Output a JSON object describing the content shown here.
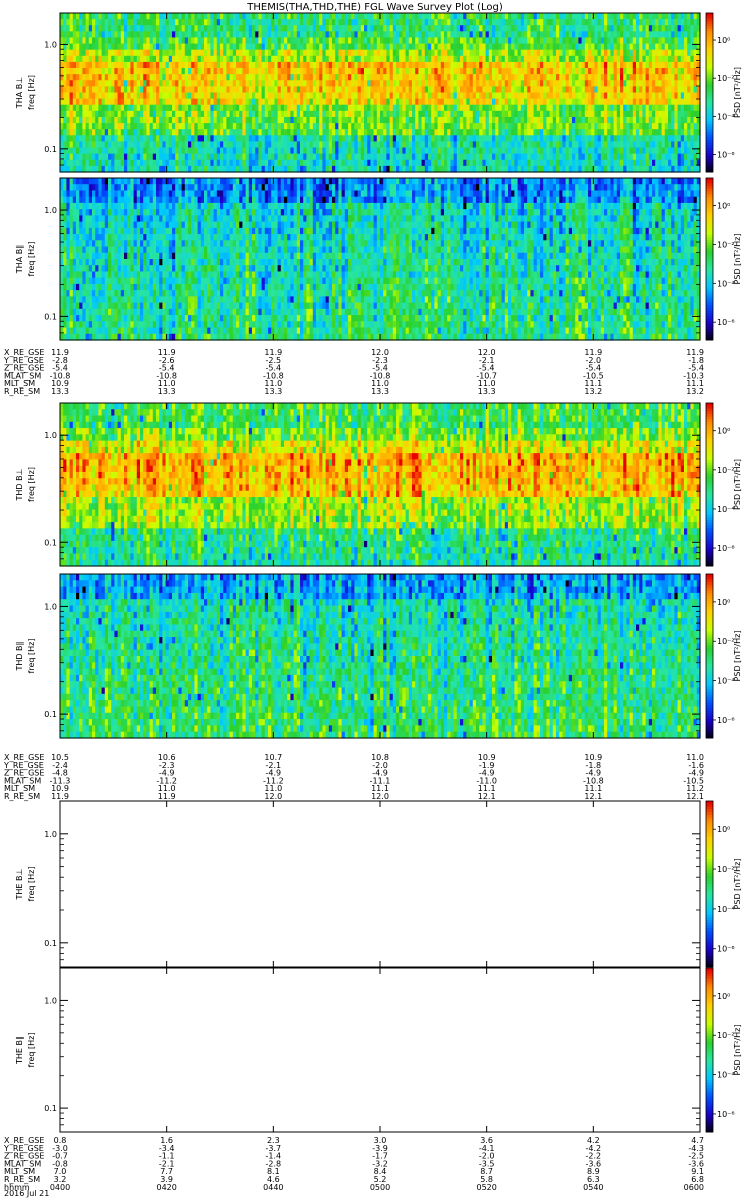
{
  "chart_data": {
    "type": "heatmap",
    "title": "THEMIS(THA,THD,THE) FGL Wave Survey Plot (Log)",
    "x_axis_type": "time",
    "x_range": [
      "0400",
      "0600"
    ],
    "y_scale": "log",
    "ylim": [
      0.06,
      2.0
    ],
    "y_ticks": [
      0.1,
      1.0
    ],
    "y_tick_labels": [
      "0.1",
      "1.0"
    ],
    "colorbar": {
      "label": "PSD [nT²/Hz]",
      "scale": "log",
      "ticks": [
        "10⁰",
        "10⁻²",
        "10⁻⁴",
        "10⁻⁶"
      ],
      "colormap": [
        "#000000",
        "#1a00c8",
        "#0050ff",
        "#00c8ff",
        "#28e6a0",
        "#2bd12b",
        "#c8ff00",
        "#ffd000",
        "#ff8c00",
        "#e60000"
      ]
    },
    "panels": [
      {
        "probe": "THA",
        "component": "B⊥",
        "ylabel": "THA B⊥\nfreq [Hz]",
        "has_data": true,
        "mean_level": 0.66
      },
      {
        "probe": "THA",
        "component": "B∥",
        "ylabel": "THA B∥\nfreq [Hz]",
        "has_data": true,
        "mean_level": 0.38
      },
      {
        "probe": "THD",
        "component": "B⊥",
        "ylabel": "THD B⊥\nfreq [Hz]",
        "has_data": true,
        "mean_level": 0.7
      },
      {
        "probe": "THD",
        "component": "B∥",
        "ylabel": "THD B∥\nfreq [Hz]",
        "has_data": true,
        "mean_level": 0.4
      },
      {
        "probe": "THE",
        "component": "B⊥",
        "ylabel": "THE B⊥\nfreq [Hz]",
        "has_data": false
      },
      {
        "probe": "THE",
        "component": "B∥",
        "ylabel": "THE B∥\nfreq [Hz]",
        "has_data": false
      }
    ],
    "ephemeris_blocks": [
      {
        "probe": "THA",
        "rows": [
          {
            "label": "X_RE_GSE",
            "values": [
              "11.9",
              "11.9",
              "11.9",
              "12.0",
              "12.0",
              "11.9",
              "11.9"
            ]
          },
          {
            "label": "Y_RE_GSE",
            "values": [
              "-2.8",
              "-2.6",
              "-2.5",
              "-2.3",
              "-2.1",
              "-2.0",
              "-1.8"
            ]
          },
          {
            "label": "Z_RE_GSE",
            "values": [
              "-5.4",
              "-5.4",
              "-5.4",
              "-5.4",
              "-5.4",
              "-5.4",
              "-5.4"
            ]
          },
          {
            "label": "MLAT_SM",
            "values": [
              "-10.8",
              "-10.8",
              "-10.8",
              "-10.8",
              "-10.7",
              "-10.5",
              "-10.3"
            ]
          },
          {
            "label": "MLT_SM",
            "values": [
              "10.9",
              "11.0",
              "11.0",
              "11.0",
              "11.0",
              "11.1",
              "11.1"
            ]
          },
          {
            "label": "R_RE_SM",
            "values": [
              "13.3",
              "13.3",
              "13.3",
              "13.3",
              "13.3",
              "13.2",
              "13.2"
            ]
          }
        ]
      },
      {
        "probe": "THD",
        "rows": [
          {
            "label": "X_RE_GSE",
            "values": [
              "10.5",
              "10.6",
              "10.7",
              "10.8",
              "10.9",
              "10.9",
              "11.0"
            ]
          },
          {
            "label": "Y_RE_GSE",
            "values": [
              "-2.4",
              "-2.3",
              "-2.1",
              "-2.0",
              "-1.9",
              "-1.8",
              "-1.6"
            ]
          },
          {
            "label": "Z_RE_GSE",
            "values": [
              "-4.8",
              "-4.9",
              "-4.9",
              "-4.9",
              "-4.9",
              "-4.9",
              "-4.9"
            ]
          },
          {
            "label": "MLAT_SM",
            "values": [
              "-11.3",
              "-11.2",
              "-11.2",
              "-11.1",
              "-11.0",
              "-10.8",
              "-10.5"
            ]
          },
          {
            "label": "MLT_SM",
            "values": [
              "10.9",
              "11.0",
              "11.0",
              "11.1",
              "11.1",
              "11.1",
              "11.2"
            ]
          },
          {
            "label": "R_RE_SM",
            "values": [
              "11.9",
              "11.9",
              "12.0",
              "12.0",
              "12.1",
              "12.1",
              "12.1"
            ]
          }
        ]
      },
      {
        "probe": "THE",
        "rows": [
          {
            "label": "X_RE_GSE",
            "values": [
              "0.8",
              "1.6",
              "2.3",
              "3.0",
              "3.6",
              "4.2",
              "4.7"
            ]
          },
          {
            "label": "Y_RE_GSE",
            "values": [
              "-3.0",
              "-3.4",
              "-3.7",
              "-3.9",
              "-4.1",
              "-4.2",
              "-4.3"
            ]
          },
          {
            "label": "Z_RE_GSE",
            "values": [
              "-0.7",
              "-1.1",
              "-1.4",
              "-1.7",
              "-2.0",
              "-2.2",
              "-2.5"
            ]
          },
          {
            "label": "MLAT_SM",
            "values": [
              "-0.8",
              "-2.1",
              "-2.8",
              "-3.2",
              "-3.5",
              "-3.6",
              "-3.6"
            ]
          },
          {
            "label": "MLT_SM",
            "values": [
              "7.0",
              "7.7",
              "8.1",
              "8.4",
              "8.7",
              "8.9",
              "9.1"
            ]
          },
          {
            "label": "R_RE_SM",
            "values": [
              "3.2",
              "3.9",
              "4.6",
              "5.2",
              "5.8",
              "6.3",
              "6.8"
            ]
          },
          {
            "label": "hhmm",
            "values": [
              "0400",
              "0420",
              "0440",
              "0500",
              "0520",
              "0540",
              "0600"
            ]
          }
        ]
      }
    ],
    "date_label": "2016 Jul 21"
  }
}
